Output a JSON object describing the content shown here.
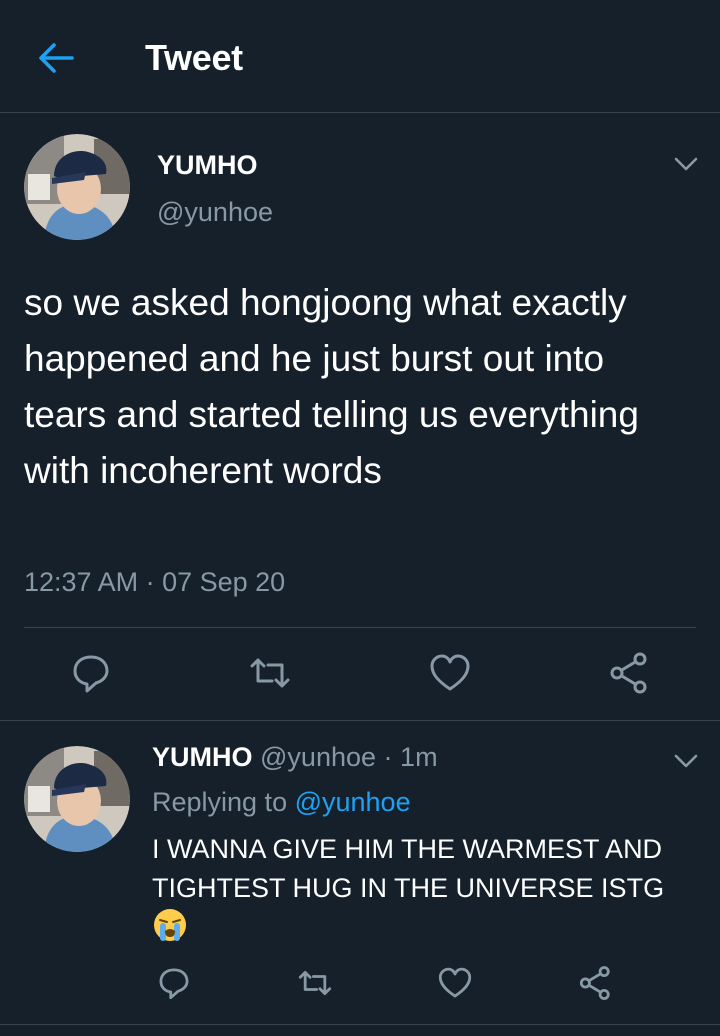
{
  "header": {
    "title": "Tweet",
    "back_icon": "arrow-left-icon"
  },
  "colors": {
    "background": "#15202b",
    "accent": "#1da1f2",
    "secondary_text": "#8899a6",
    "divider": "#38444d"
  },
  "tweet": {
    "display_name": "YUMHO",
    "handle": "@yunhoe",
    "text": "so we asked hongjoong what exactly happened and he just burst out into tears and started telling us everything with incoherent words",
    "timestamp": "12:37 AM · 07 Sep 20",
    "actions": [
      "reply-icon",
      "retweet-icon",
      "like-icon",
      "share-icon"
    ]
  },
  "reply": {
    "display_name": "YUMHO",
    "handle": "@yunhoe",
    "separator": "·",
    "time": "1m",
    "replying_prefix": "Replying to ",
    "replying_to": "@yunhoe",
    "text": "I WANNA GIVE HIM THE WARMEST AND TIGHTEST HUG IN THE UNIVERSE ISTG",
    "emoji": "loudly-crying-face-emoji",
    "actions": [
      "reply-icon",
      "retweet-icon",
      "like-icon",
      "share-icon"
    ]
  }
}
